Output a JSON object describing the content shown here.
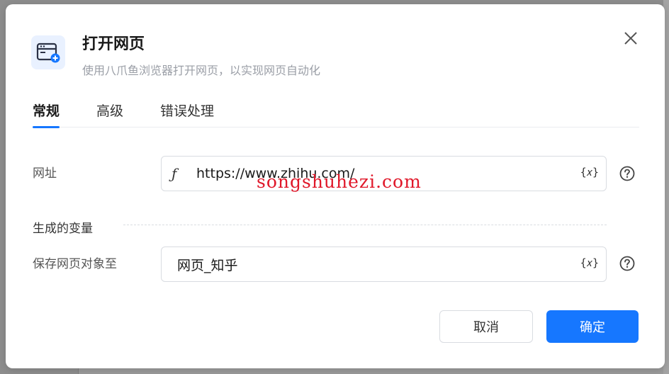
{
  "dialog": {
    "title": "打开网页",
    "subtitle": "使用八爪鱼浏览器打开网页，以实现网页自动化",
    "icon": "browser-window-add-icon",
    "accent_color": "#1677ff"
  },
  "tabs": [
    {
      "label": "常规",
      "active": true
    },
    {
      "label": "高级",
      "active": false
    },
    {
      "label": "错误处理",
      "active": false
    }
  ],
  "url_field": {
    "label": "网址",
    "value": "https://www.zhihu.com/",
    "prefix_icon": "function-icon",
    "variable_button": "{𝑥}"
  },
  "output_section": {
    "title": "生成的变量"
  },
  "save_field": {
    "label": "保存网页对象至",
    "value": "网页_知乎",
    "variable_button": "{𝑥}"
  },
  "buttons": {
    "cancel": "取消",
    "ok": "确定"
  },
  "watermark": "songshuhezi.com"
}
